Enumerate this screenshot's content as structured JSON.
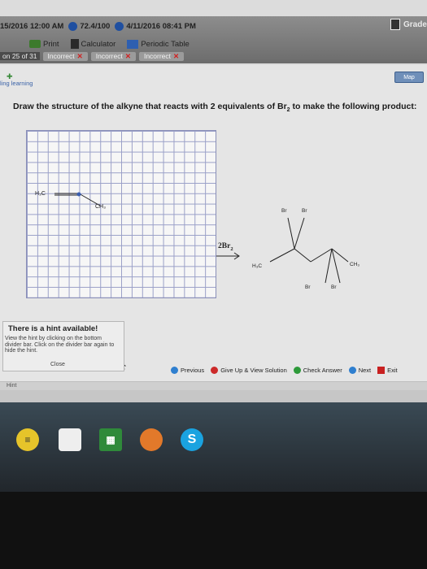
{
  "status_bar": {
    "date_start": "15/2016 12:00 AM",
    "score": "72.4/100",
    "date_due": "4/11/2016 08:41 PM",
    "gradebook_label": "Gradeb"
  },
  "tools": {
    "print": "Print",
    "calculator": "Calculator",
    "periodic_table": "Periodic Table"
  },
  "question_nav": {
    "counter": "on 25 of 31",
    "statuses": [
      "Incorrect",
      "Incorrect",
      "Incorrect"
    ]
  },
  "brand": {
    "logo_text": "ling learning",
    "map_label": "Map"
  },
  "question": {
    "prompt_before": "Draw the structure of the alkyne that reacts with 2 equivalents of Br",
    "prompt_sub": "2",
    "prompt_after": " to make the following product:"
  },
  "drawing": {
    "left_group": "H₃C",
    "right_group": "CH₃"
  },
  "reaction": {
    "reagent_main": "2Br",
    "reagent_sub": "2",
    "product_labels": {
      "br_top_left": "Br",
      "br_top_right": "Br",
      "br_bottom_left": "Br",
      "br_bottom_right": "Br",
      "h3c": "H₃C",
      "ch3": "CH₃"
    }
  },
  "hint": {
    "title": "There is a hint available!",
    "body": "View the hint by clicking on the bottom divider bar. Click on the divider bar again to hide the hint.",
    "close": "Close"
  },
  "nav_buttons": {
    "previous": "Previous",
    "give_up": "Give Up & View Solution",
    "check": "Check Answer",
    "next": "Next",
    "exit": "Exit"
  },
  "hint_bar": "Hint",
  "taskbar": {
    "skype": "S"
  },
  "colors": {
    "incorrect_x": "#d12020",
    "grid_line": "#9aa0c8",
    "nav_blue": "#2f7fcf",
    "nav_red": "#cc2a2a",
    "nav_green": "#2d9a3a"
  }
}
